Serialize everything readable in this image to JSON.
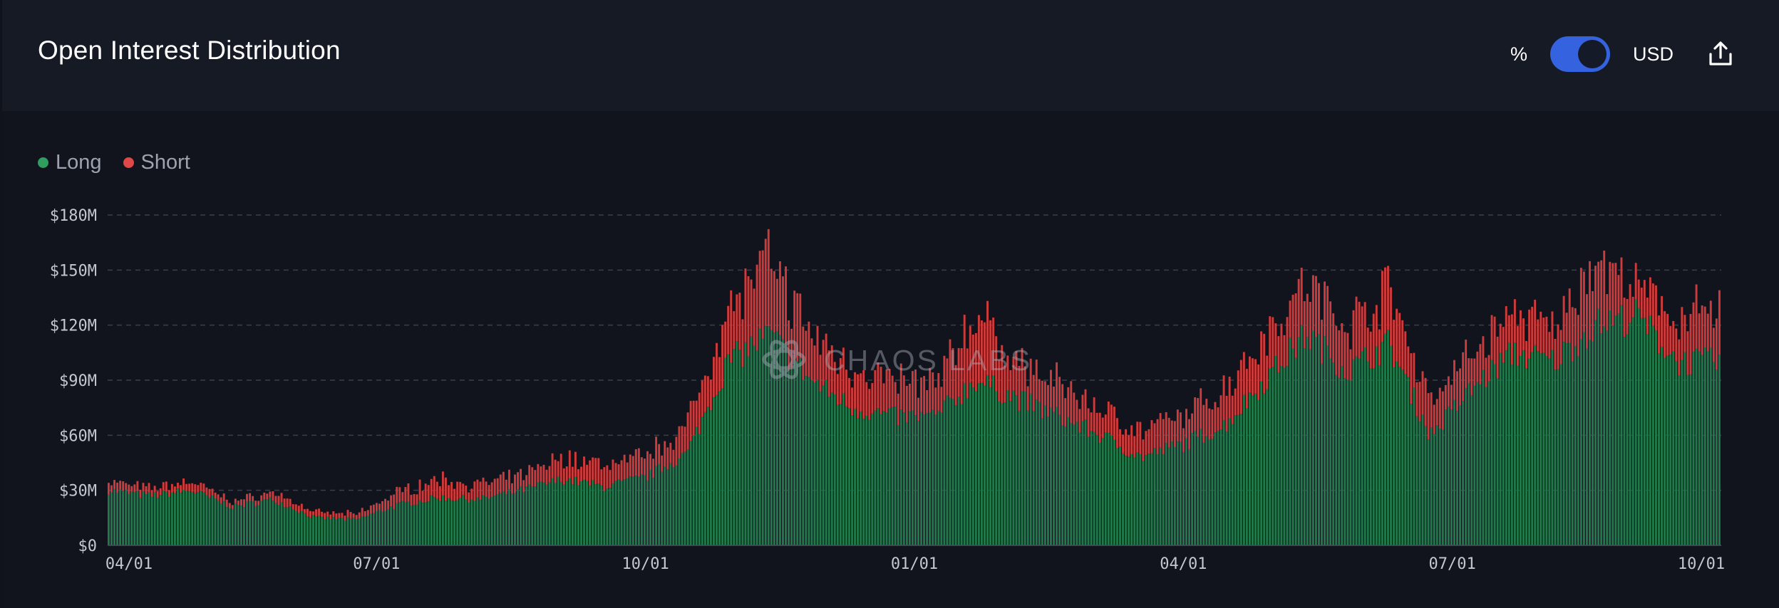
{
  "header": {
    "title": "Open Interest Distribution",
    "toggle_left_label": "%",
    "toggle_right_label": "USD",
    "toggle_selected": "USD",
    "export_icon": "upload-icon"
  },
  "watermark": "CHAOS LABS",
  "colors": {
    "long": "#1f7a4a",
    "short": "#cf3a3a",
    "legend_long": "#2f9e5f",
    "legend_short": "#e04848",
    "toggle": "#3563e0"
  },
  "chart_data": {
    "type": "bar",
    "stacked": true,
    "legend": [
      {
        "name": "Long"
      },
      {
        "name": "Short"
      }
    ],
    "x_ticks": [
      "04/01",
      "07/01",
      "10/01",
      "01/01",
      "04/01",
      "07/01",
      "10/01"
    ],
    "y_ticks": [
      "$0",
      "$30M",
      "$60M",
      "$90M",
      "$120M",
      "$150M",
      "$180M"
    ],
    "ylim": [
      0,
      180
    ],
    "y_unit": "$M",
    "grid": true,
    "legend_position": "top-left",
    "anchors": [
      {
        "x": "04/01",
        "long": 30,
        "short": 5
      },
      {
        "x": "05/01",
        "long": 27,
        "short": 4
      },
      {
        "x": "05/15",
        "long": 30,
        "short": 5
      },
      {
        "x": "06/01",
        "long": 21,
        "short": 3
      },
      {
        "x": "06/15",
        "long": 25,
        "short": 4
      },
      {
        "x": "07/01",
        "long": 15,
        "short": 3
      },
      {
        "x": "07/20",
        "long": 14,
        "short": 3
      },
      {
        "x": "08/05",
        "long": 22,
        "short": 7
      },
      {
        "x": "08/20",
        "long": 26,
        "short": 10
      },
      {
        "x": "09/05",
        "long": 25,
        "short": 8
      },
      {
        "x": "09/20",
        "long": 30,
        "short": 8
      },
      {
        "x": "10/01",
        "long": 36,
        "short": 12
      },
      {
        "x": "10/15",
        "long": 32,
        "short": 12
      },
      {
        "x": "11/01",
        "long": 37,
        "short": 12
      },
      {
        "x": "11/15",
        "long": 50,
        "short": 15
      },
      {
        "x": "11/25",
        "long": 100,
        "short": 30
      },
      {
        "x": "11/29",
        "long": 115,
        "short": 40
      },
      {
        "x": "12/05",
        "long": 90,
        "short": 25
      },
      {
        "x": "12/20",
        "long": 75,
        "short": 22
      },
      {
        "x": "01/05",
        "long": 70,
        "short": 20
      },
      {
        "x": "01/20",
        "long": 70,
        "short": 18
      },
      {
        "x": "02/05",
        "long": 90,
        "short": 35
      },
      {
        "x": "02/15",
        "long": 80,
        "short": 20
      },
      {
        "x": "03/01",
        "long": 70,
        "short": 18
      },
      {
        "x": "03/20",
        "long": 60,
        "short": 15
      },
      {
        "x": "04/01",
        "long": 48,
        "short": 14
      },
      {
        "x": "04/20",
        "long": 55,
        "short": 15
      },
      {
        "x": "05/05",
        "long": 65,
        "short": 20
      },
      {
        "x": "05/25",
        "long": 90,
        "short": 25
      },
      {
        "x": "06/10",
        "long": 115,
        "short": 28
      },
      {
        "x": "06/20",
        "long": 95,
        "short": 25
      },
      {
        "x": "07/01",
        "long": 110,
        "short": 30
      },
      {
        "x": "07/10",
        "long": 60,
        "short": 20
      },
      {
        "x": "07/25",
        "long": 85,
        "short": 20
      },
      {
        "x": "08/10",
        "long": 105,
        "short": 22
      },
      {
        "x": "08/25",
        "long": 100,
        "short": 18
      },
      {
        "x": "09/05",
        "long": 120,
        "short": 35
      },
      {
        "x": "09/15",
        "long": 125,
        "short": 15
      },
      {
        "x": "09/25",
        "long": 100,
        "short": 25
      },
      {
        "x": "10/01",
        "long": 100,
        "short": 28
      }
    ]
  }
}
